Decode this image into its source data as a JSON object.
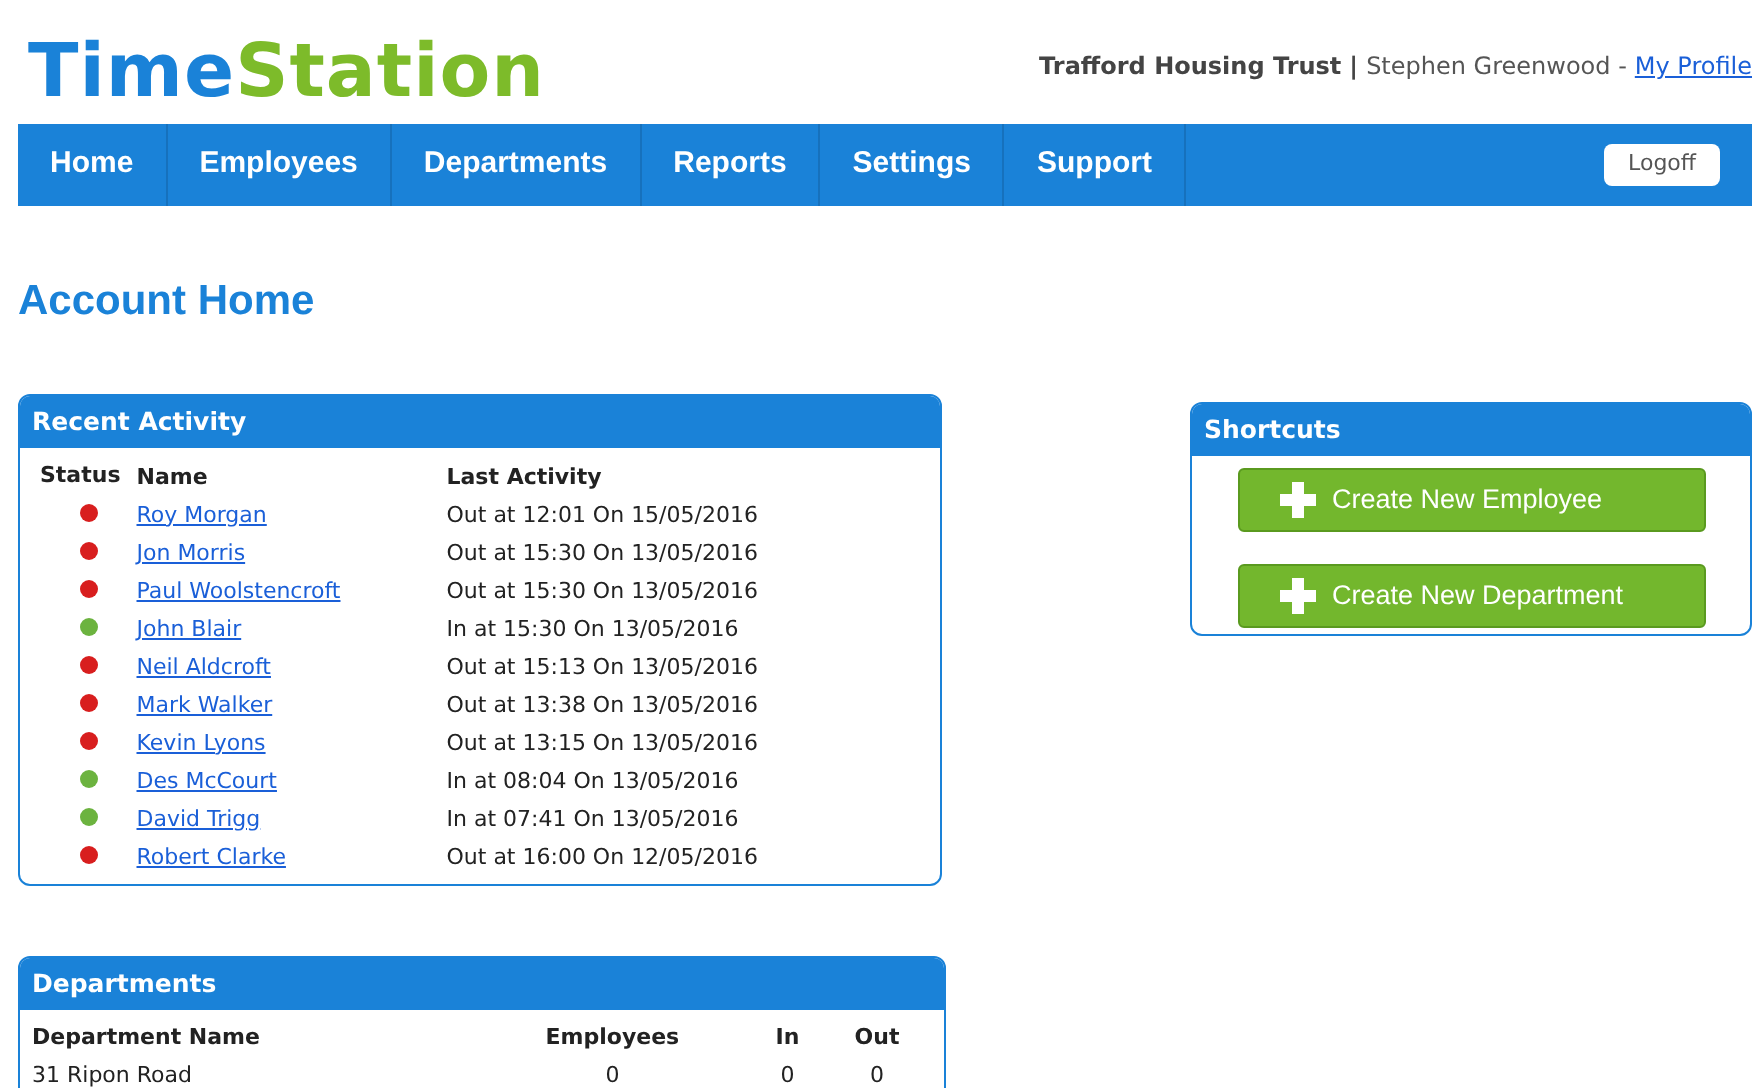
{
  "logo": {
    "part_1": "Time",
    "part_2": "Station"
  },
  "account": {
    "organisation": "Trafford Housing Trust",
    "separator": "|",
    "user": "Stephen Greenwood -",
    "profile_link": "My Profile"
  },
  "nav": {
    "items": [
      {
        "label": "Home"
      },
      {
        "label": "Employees"
      },
      {
        "label": "Departments"
      },
      {
        "label": "Reports"
      },
      {
        "label": "Settings"
      },
      {
        "label": "Support"
      }
    ],
    "logoff": "Logoff"
  },
  "page_title": "Account Home",
  "recent_activity": {
    "title": "Recent Activity",
    "columns": [
      "Status",
      "Name",
      "Last Activity"
    ],
    "rows": [
      {
        "color": "#d81e1e",
        "name": "Roy Morgan",
        "activity": "Out at 12:01 On 15/05/2016"
      },
      {
        "color": "#d81e1e",
        "name": "Jon Morris",
        "activity": "Out at 15:30 On 13/05/2016"
      },
      {
        "color": "#d81e1e",
        "name": "Paul Woolstencroft",
        "activity": "Out at 15:30 On 13/05/2016"
      },
      {
        "color": "#6cb33f",
        "name": "John Blair",
        "activity": "In at 15:30 On 13/05/2016"
      },
      {
        "color": "#d81e1e",
        "name": "Neil Aldcroft",
        "activity": "Out at 15:13 On 13/05/2016"
      },
      {
        "color": "#d81e1e",
        "name": "Mark Walker",
        "activity": "Out at 13:38 On 13/05/2016"
      },
      {
        "color": "#d81e1e",
        "name": "Kevin Lyons",
        "activity": "Out at 13:15 On 13/05/2016"
      },
      {
        "color": "#6cb33f",
        "name": "Des McCourt",
        "activity": "In at 08:04 On 13/05/2016"
      },
      {
        "color": "#6cb33f",
        "name": "David Trigg",
        "activity": "In at 07:41 On 13/05/2016"
      },
      {
        "color": "#d81e1e",
        "name": "Robert Clarke",
        "activity": "Out at 16:00 On 12/05/2016"
      }
    ]
  },
  "shortcuts": {
    "title": "Shortcuts",
    "buttons": [
      "Create New Employee",
      "Create New Department"
    ]
  },
  "departments": {
    "title": "Departments",
    "columns": [
      "Department Name",
      "Employees",
      "In",
      "Out"
    ],
    "rows": [
      [
        "31 Ripon Road",
        "0",
        "0",
        "0"
      ]
    ]
  }
}
